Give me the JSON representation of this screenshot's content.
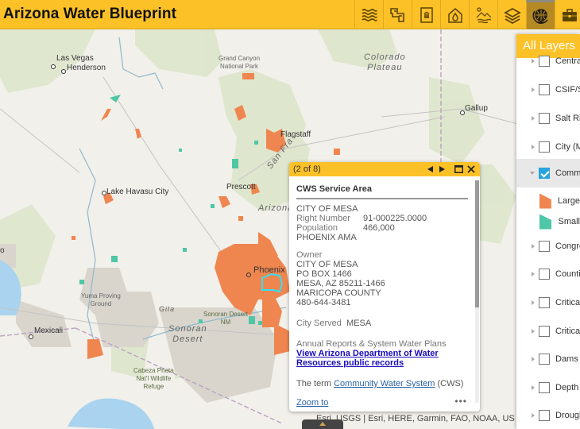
{
  "header": {
    "title": "Arizona Water Blueprint",
    "tools": [
      {
        "icon": "water-waves-icon",
        "label": "Water"
      },
      {
        "icon": "canal-icon",
        "label": "Canals"
      },
      {
        "icon": "building-document-icon",
        "label": "Institutions"
      },
      {
        "icon": "water-drop-house-icon",
        "label": "Water Supply"
      },
      {
        "icon": "landscape-icon",
        "label": "Landscape"
      },
      {
        "icon": "layers-icon",
        "label": "Layers"
      },
      {
        "icon": "globe-icon",
        "label": "Basemap",
        "active": true
      },
      {
        "icon": "toolbox-icon",
        "label": "Tools"
      }
    ]
  },
  "map": {
    "places": {
      "las_vegas": "Las Vegas",
      "henderson": "Henderson",
      "grand_canyon": "Grand Canyon\nNational Park",
      "colorado_plateau": "Colorado\nPlateau",
      "gallup": "Gallup",
      "flagstaff": "Flagstaff",
      "san_fra": "San Fra",
      "prescott": "Prescott",
      "lake_havasu": "Lake Havasu City",
      "arizona": "Arizona",
      "phoenix": "Phoenix",
      "yuma_proving": "Yuma Proving\nGround",
      "gila": "Gila",
      "sonoran_nm": "Sonoran Desert\nNM",
      "sonoran_desert": "Sonoran\nDesert",
      "mexicali": "Mexicali",
      "cabeza": "Cabeza Prieta\nNat'l Wildlife\nRefuge",
      "edge_o": "o"
    },
    "attribution": "Esri, USGS | Esri, HERE, Garmin, FAO, NOAA, US"
  },
  "layers_panel": {
    "title": "All Layers",
    "layers": [
      {
        "label": "Central Arizona Project",
        "checked": false
      },
      {
        "label": "CSIF/SRP",
        "checked": false
      },
      {
        "label": "Salt River Project",
        "checked": false
      },
      {
        "label": "City (Municipal)",
        "checked": false
      },
      {
        "label": "Community Water Systems",
        "checked": true,
        "expanded": true
      },
      {
        "label": "Congressional Districts",
        "checked": false
      },
      {
        "label": "Counties",
        "checked": false
      },
      {
        "label": "Critical Habitat",
        "checked": false
      },
      {
        "label": "Critical Areas",
        "checked": false
      },
      {
        "label": "Dams & Reservoirs",
        "checked": false
      },
      {
        "label": "Depth to Groundwater",
        "checked": false
      },
      {
        "label": "Drought",
        "checked": false
      }
    ],
    "legend": [
      {
        "label": "Large",
        "color": "#ef8650"
      },
      {
        "label": "Small",
        "color": "#4fc6a6"
      }
    ]
  },
  "popup": {
    "count": "(2 of 8)",
    "title": "CWS Service Area",
    "name": "CITY OF MESA",
    "right_number_label": "Right Number",
    "right_number": "91-000225.0000",
    "population_label": "Population",
    "population": "466,000",
    "ama": "PHOENIX AMA",
    "owner_label": "Owner",
    "owner_lines": [
      "CITY OF MESA",
      "PO BOX 1466",
      "MESA, AZ 85211-1466",
      "MARICOPA COUNTY",
      "480-644-3481"
    ],
    "city_served_label": "City Served",
    "city_served": "MESA",
    "reports_label": "Annual Reports & System Water Plans",
    "reports_link": "View Arizona Department of Water Resources public records",
    "term_prefix": "The term",
    "term_link": "Community Water System",
    "term_suffix": "(CWS)",
    "zoom_to": "Zoom to",
    "more": "•••"
  },
  "colors": {
    "brand": "#fdc128",
    "large_cws": "#ef8650",
    "small_cws": "#4fc6a6",
    "selected_outline": "#33e0f0"
  }
}
